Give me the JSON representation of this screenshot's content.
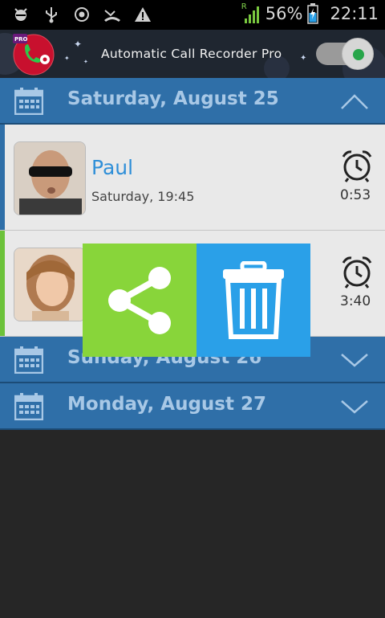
{
  "status_bar": {
    "battery_percent": "56%",
    "time": "22:11",
    "signal_label": "R",
    "icons_left": [
      "android-debug-icon",
      "usb-icon",
      "location-icon",
      "missed-call-icon",
      "warning-icon"
    ]
  },
  "app": {
    "title": "Automatic Call Recorder Pro",
    "logo_badge": "PRO",
    "recording_enabled": true,
    "colors": {
      "header": "#2f6fa8",
      "accent": "#2f8fd8",
      "share": "#88d53a",
      "delete": "#2aa0e8"
    }
  },
  "groups": [
    {
      "label": "Saturday, August 25",
      "expanded": true,
      "calls": [
        {
          "name": "Paul",
          "when": "Saturday, 19:45",
          "duration": "0:53",
          "stripe": "#2f6fa8"
        },
        {
          "name": "",
          "when": "",
          "duration": "3:40",
          "stripe": "#6cc23a"
        }
      ]
    },
    {
      "label": "Sunday, August 26",
      "expanded": false
    },
    {
      "label": "Monday, August 27",
      "expanded": false
    }
  ],
  "actions": {
    "share_icon": "share-icon",
    "delete_icon": "trash-icon"
  }
}
